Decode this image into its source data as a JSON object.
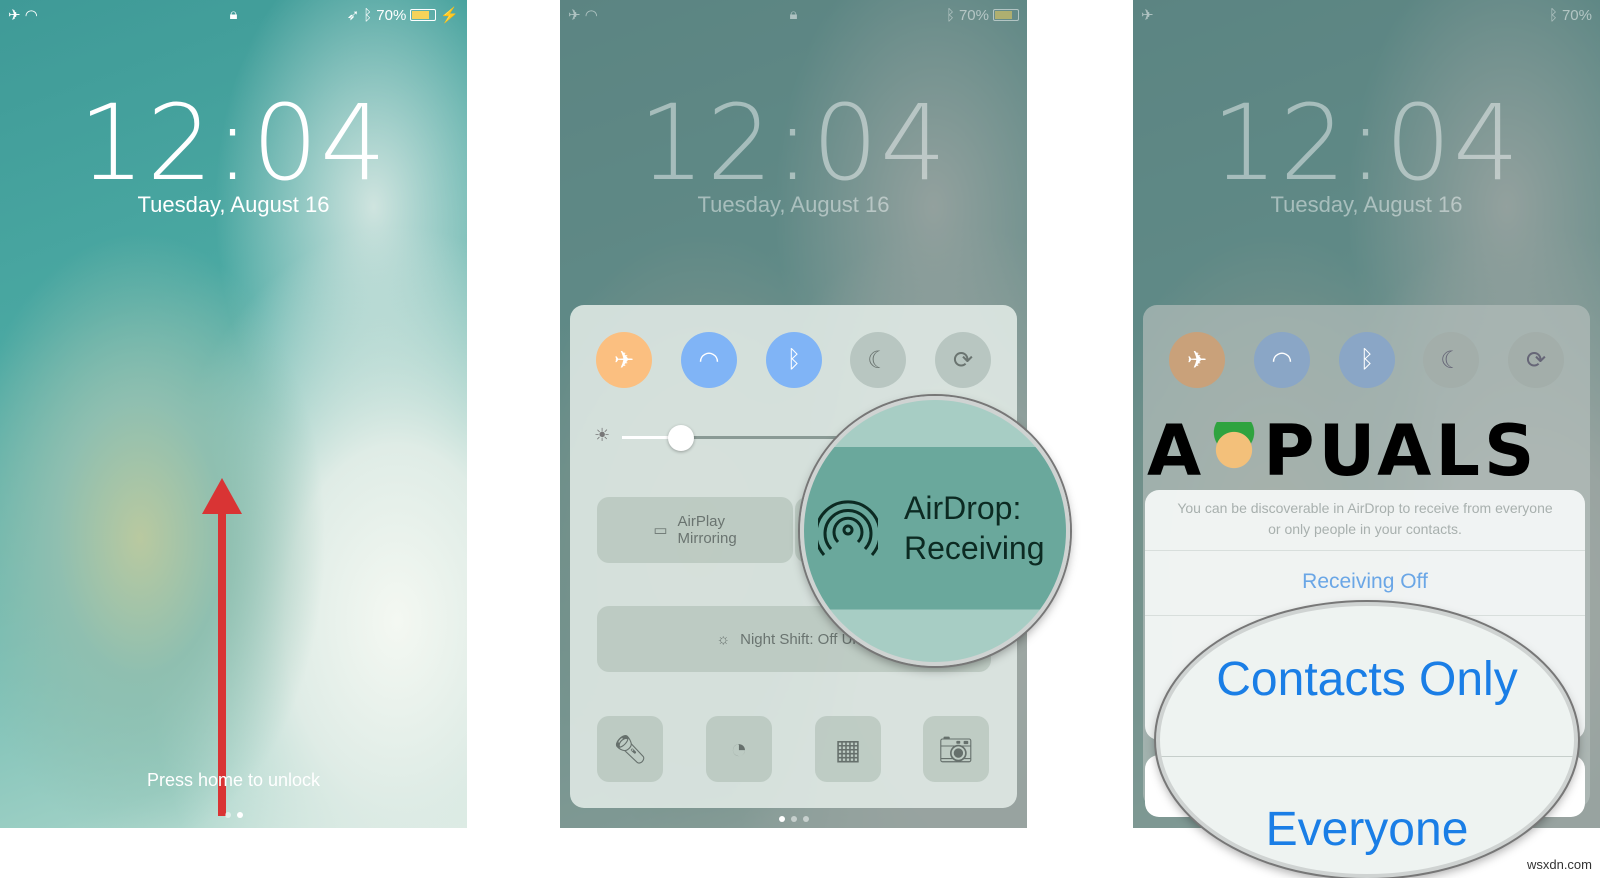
{
  "status_bar": {
    "battery": "70%",
    "battery_level": 0.7,
    "battery_color": "#f6d35a"
  },
  "lock": {
    "time": "12:04",
    "date": "Tuesday, August 16",
    "hint": "Press home to unlock",
    "page_dots": 2,
    "active_dot": 1,
    "arrow_color": "#d93434"
  },
  "control_center": {
    "toggles": [
      {
        "name": "airplane",
        "on": true,
        "color": "#fbbf80"
      },
      {
        "name": "wifi",
        "on": true,
        "color": "#80b4f6"
      },
      {
        "name": "bluetooth",
        "on": true,
        "color": "#80b4f6"
      },
      {
        "name": "do-not-disturb",
        "on": false
      },
      {
        "name": "rotation-lock",
        "on": false
      }
    ],
    "brightness": 0.2,
    "airplay": "AirPlay\nMirroring",
    "airdrop_line1": "AirDrop:",
    "airdrop_line2": "Receiving",
    "night_shift": "Night Shift: Off Until",
    "shortcuts": [
      "flashlight",
      "timer",
      "calculator",
      "camera"
    ],
    "page_dots": 3,
    "active_dot": 0
  },
  "airdrop_sheet": {
    "description": "You can be discoverable in AirDrop to receive from everyone or only people in your contacts.",
    "options": [
      "Receiving Off",
      "Contacts Only",
      "Everyone"
    ],
    "accent": "#1a7ee6"
  },
  "logo": "APPUALS",
  "watermark": "wsxdn.com"
}
